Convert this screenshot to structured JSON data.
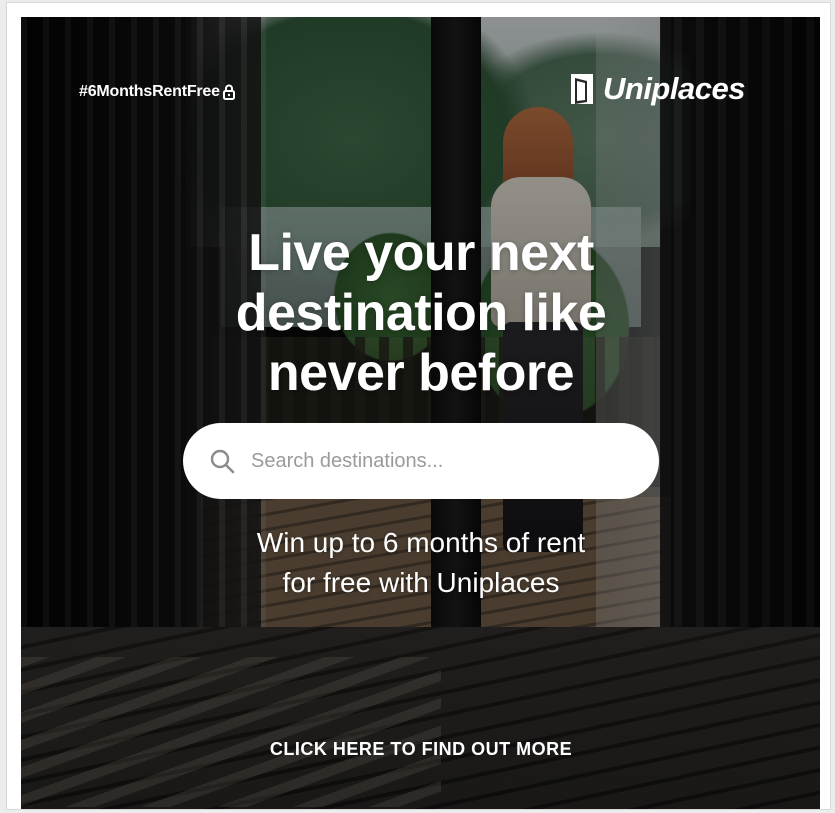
{
  "banner": {
    "hashtag": "#6MonthsRentFree",
    "hashtag_icon": "lock-icon",
    "logo_text": "Uniplaces",
    "logo_icon": "uniplaces-door-icon",
    "headline_lines": [
      "Live your next",
      "destination like",
      "never before"
    ],
    "search": {
      "placeholder": "Search destinations...",
      "value": "",
      "icon": "search-icon"
    },
    "subline_lines": [
      "Win up to 6 months of rent",
      "for free with Uniplaces"
    ],
    "cta_label": "CLICK HERE TO FIND OUT MORE"
  },
  "colors": {
    "text": "#ffffff",
    "search_bg": "#ffffff",
    "placeholder": "#9b9b9b",
    "icon": "#8c8c8c"
  }
}
